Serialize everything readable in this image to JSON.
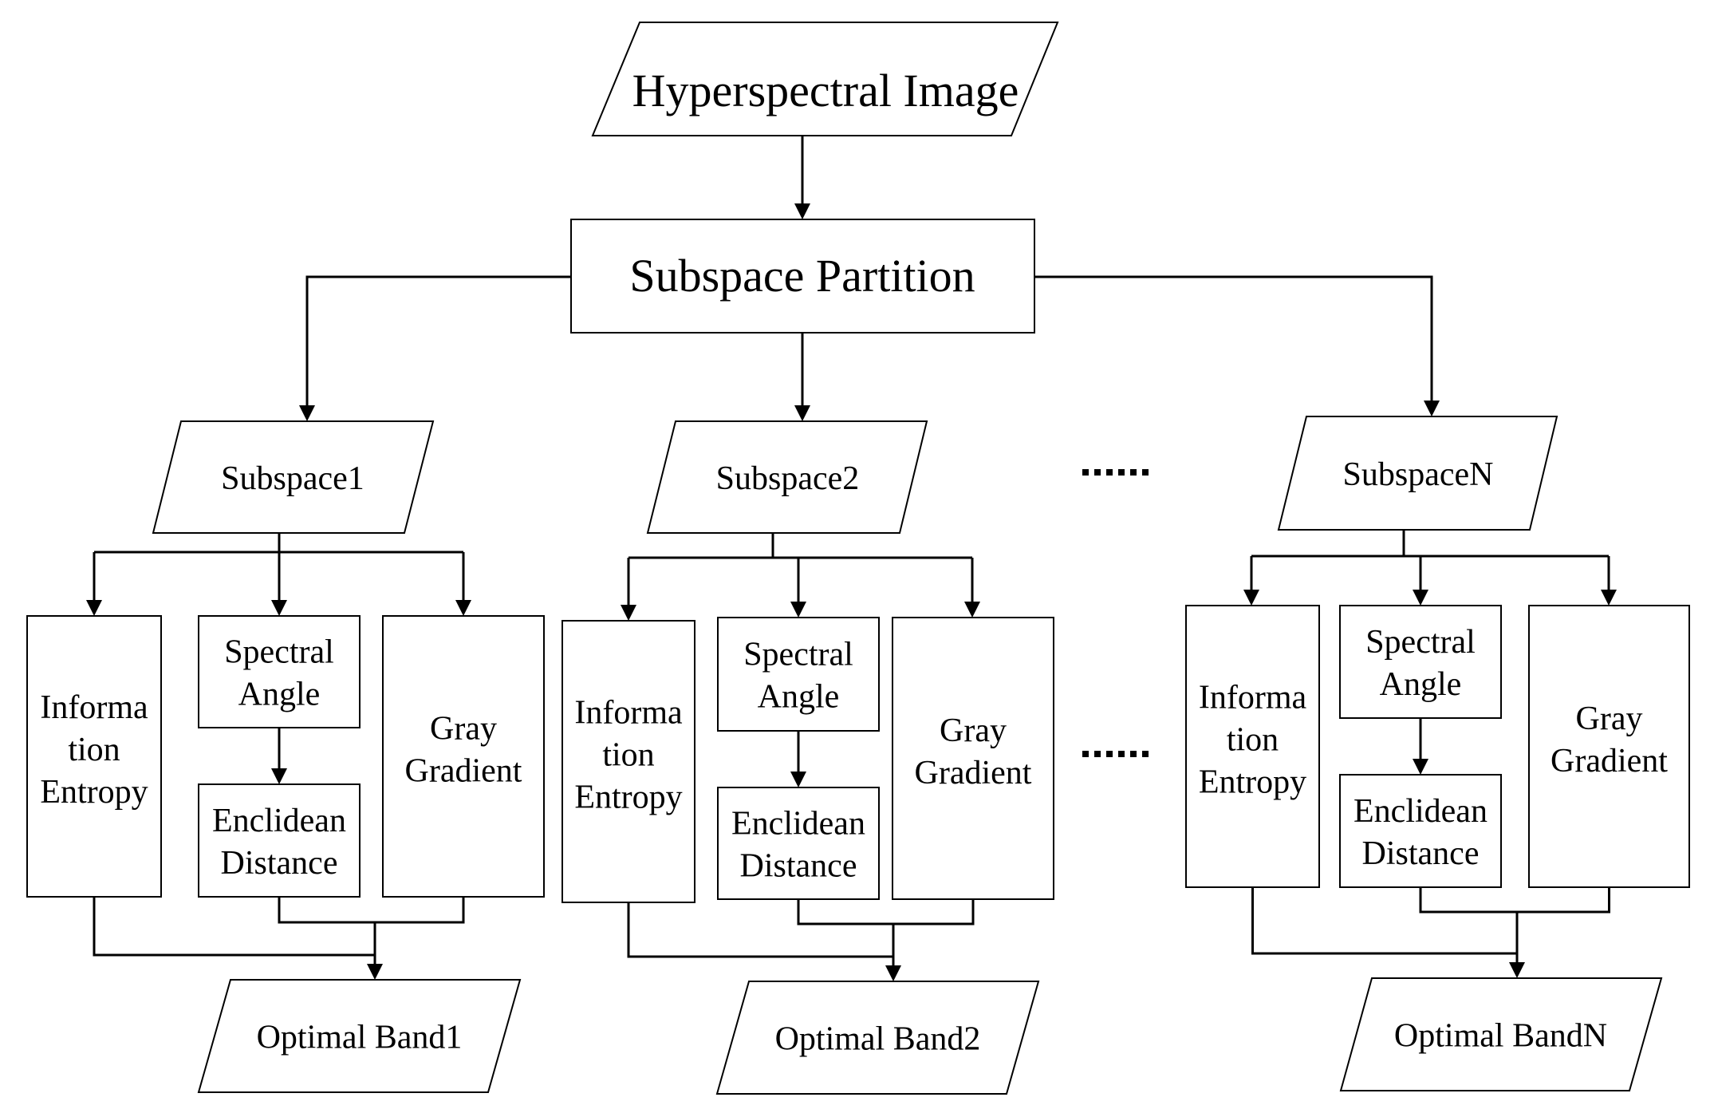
{
  "diagram": {
    "input": "Hyperspectral Image",
    "partition": "Subspace Partition",
    "ellipsis": "......",
    "columns": [
      {
        "subspace": "Subspace1",
        "info_entropy": [
          "Informa",
          "tion",
          "Entropy"
        ],
        "spectral_angle": [
          "Spectral",
          "Angle"
        ],
        "euclidean": [
          "Enclidean",
          "Distance"
        ],
        "gray_gradient": [
          "Gray",
          "Gradient"
        ],
        "output": "Optimal Band1"
      },
      {
        "subspace": "Subspace2",
        "info_entropy": [
          "Informa",
          "tion",
          "Entropy"
        ],
        "spectral_angle": [
          "Spectral",
          "Angle"
        ],
        "euclidean": [
          "Enclidean",
          "Distance"
        ],
        "gray_gradient": [
          "Gray",
          "Gradient"
        ],
        "output": "Optimal Band2"
      },
      {
        "subspace": "SubspaceN",
        "info_entropy": [
          "Informa",
          "tion",
          "Entropy"
        ],
        "spectral_angle": [
          "Spectral",
          "Angle"
        ],
        "euclidean": [
          "Enclidean",
          "Distance"
        ],
        "gray_gradient": [
          "Gray",
          "Gradient"
        ],
        "output": "Optimal BandN"
      }
    ]
  }
}
